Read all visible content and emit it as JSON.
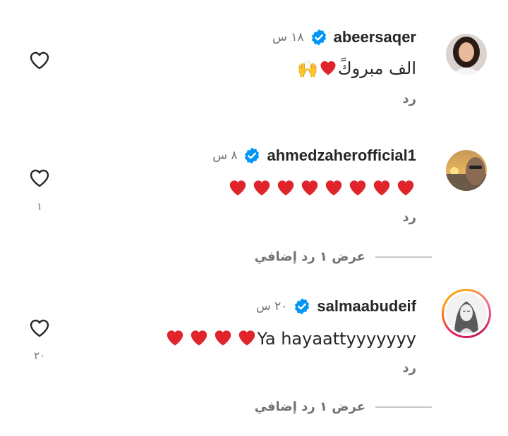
{
  "comments": [
    {
      "username": "abeersaqer",
      "time": "١٨ س",
      "text": "الف مبروكً",
      "emoji_hearts": 1,
      "emoji_extra": "🙌",
      "reply_label": "رد",
      "like_count": "",
      "verified": true,
      "avatar_icon": "woman-portrait"
    },
    {
      "username": "ahmedzaherofficial1",
      "time": "٨ س",
      "text": "",
      "emoji_hearts": 8,
      "reply_label": "رد",
      "like_count": "١",
      "verified": true,
      "avatar_icon": "man-sunset-portrait",
      "view_replies_label": "عرض ١ رد إضافي"
    },
    {
      "username": "salmaabudeif",
      "time": "٢٠ س",
      "text": "Ya hayaattyyyyyyy",
      "emoji_hearts": 4,
      "reply_label": "رد",
      "like_count": "٢٠",
      "verified": true,
      "avatar_icon": "woman-sketch-portrait",
      "has_story_ring": true,
      "view_replies_label": "عرض ١ رد إضافي"
    }
  ],
  "colors": {
    "verified_blue": "#0095f6",
    "heart_red": "#e0242b",
    "secondary_text": "#737373"
  }
}
